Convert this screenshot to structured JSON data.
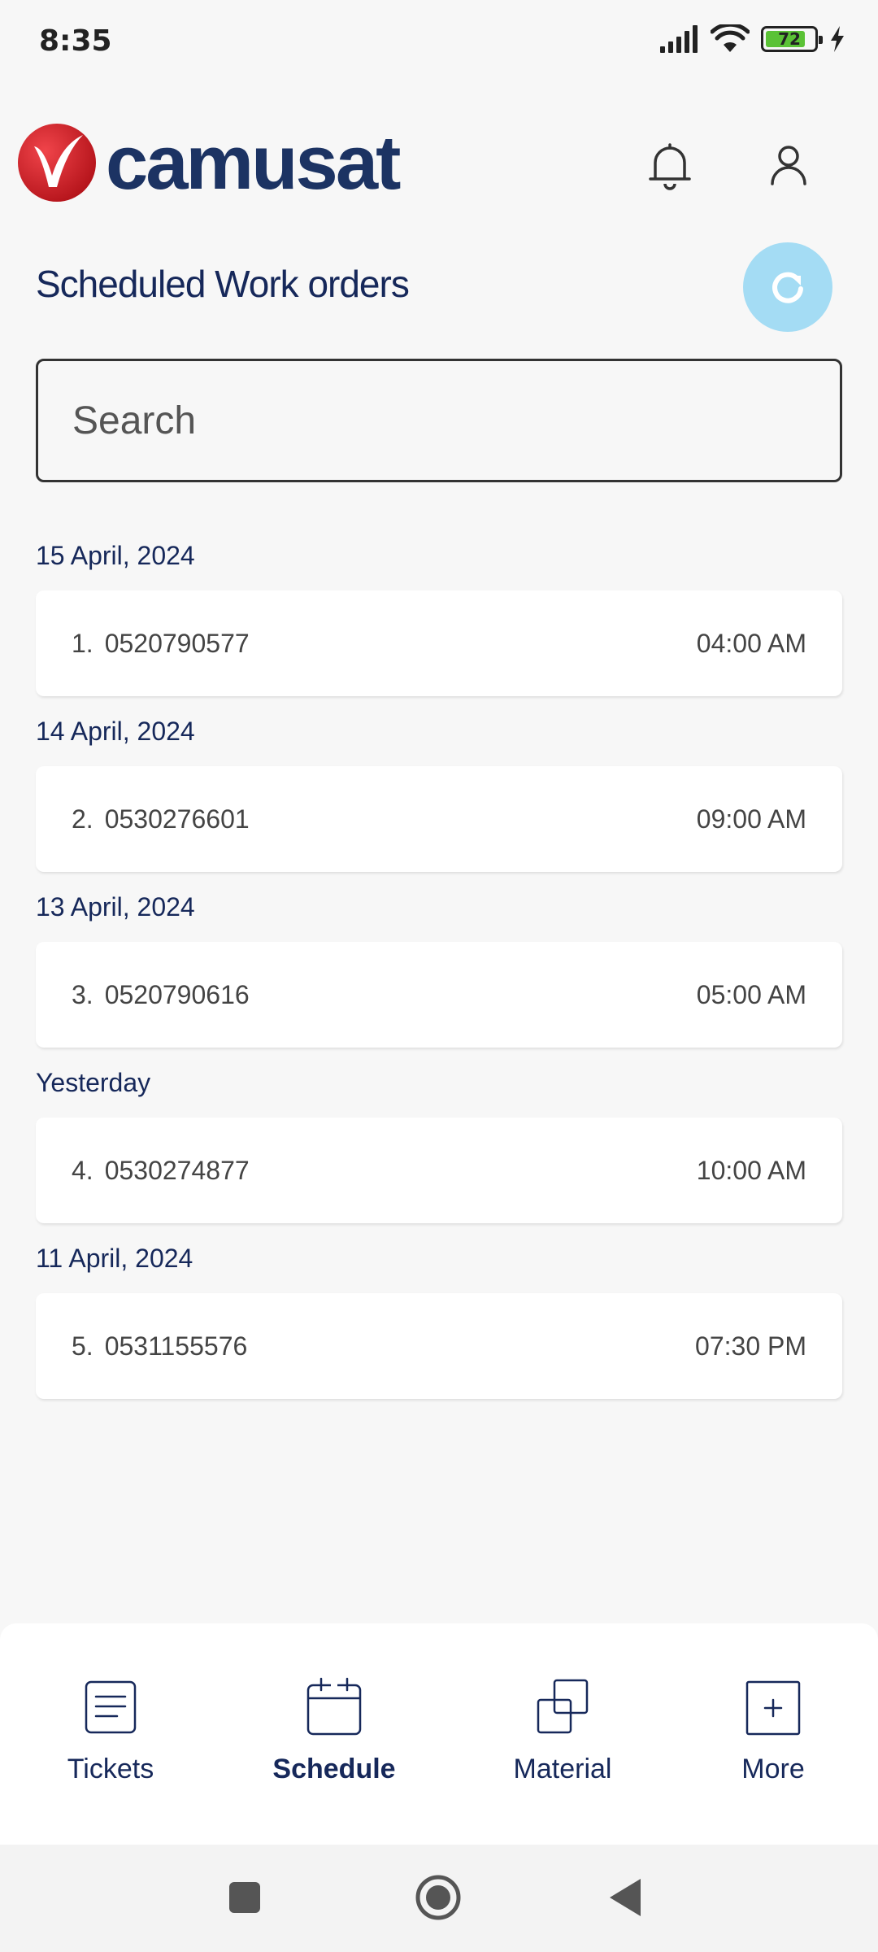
{
  "status_bar": {
    "time": "8:35",
    "battery_level": "72",
    "icons": [
      "signal-icon",
      "wifi-icon",
      "battery-icon",
      "charging-icon"
    ]
  },
  "header": {
    "logo_text": "camusat",
    "bell_icon": "bell-icon",
    "profile_icon": "user-icon"
  },
  "page": {
    "title": "Scheduled Work orders",
    "refresh_icon": "refresh-icon"
  },
  "search": {
    "placeholder": "Search",
    "value": ""
  },
  "work_orders": [
    {
      "date": "15 April, 2024",
      "index": "1.",
      "number": "0520790577",
      "time": "04:00 AM"
    },
    {
      "date": "14 April, 2024",
      "index": "2.",
      "number": "0530276601",
      "time": "09:00 AM"
    },
    {
      "date": "13 April, 2024",
      "index": "3.",
      "number": "0520790616",
      "time": "05:00 AM"
    },
    {
      "date": "Yesterday",
      "index": "4.",
      "number": "0530274877",
      "time": "10:00 AM"
    },
    {
      "date": "11 April, 2024",
      "index": "5.",
      "number": "0531155576",
      "time": "07:30 PM"
    }
  ],
  "bottom_nav": {
    "items": [
      {
        "label": "Tickets",
        "icon": "document-icon"
      },
      {
        "label": "Schedule",
        "icon": "calendar-icon",
        "active": true
      },
      {
        "label": "Material",
        "icon": "layers-icon"
      },
      {
        "label": "More",
        "icon": "plus-square-icon"
      }
    ]
  },
  "system_nav": [
    "recents-icon",
    "home-icon",
    "back-icon"
  ],
  "colors": {
    "primary": "#16285a",
    "logo_blue": "#1c3363",
    "logo_red": "#d7282f",
    "refresh_bg": "#a4dcf4",
    "background": "#f7f7f7",
    "card": "#ffffff"
  }
}
